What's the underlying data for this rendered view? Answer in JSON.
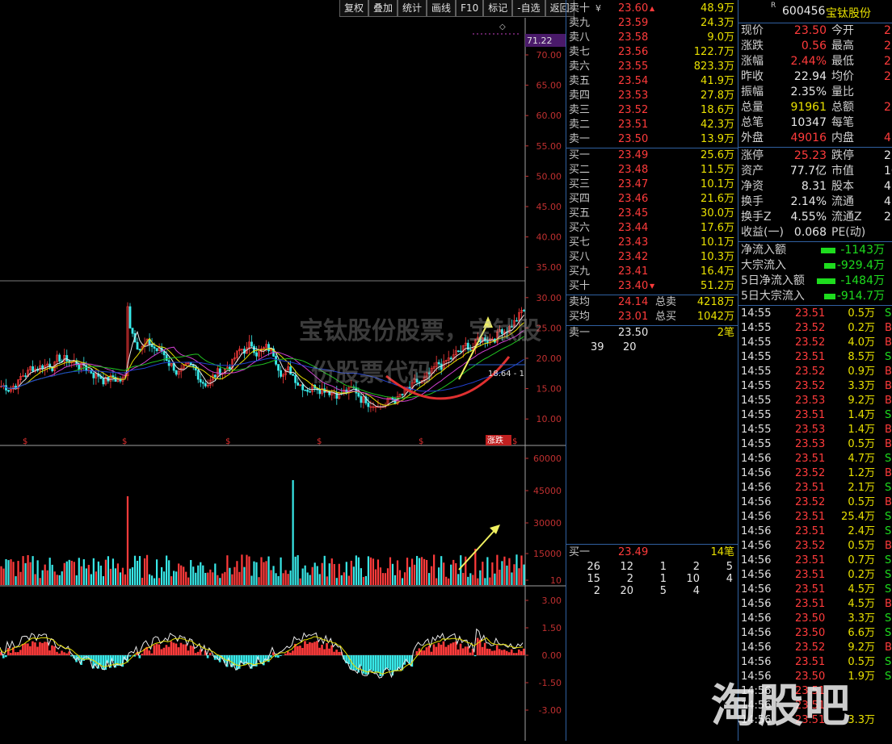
{
  "toolbar": [
    "复权",
    "叠加",
    "统计",
    "画线",
    "F10",
    "标记",
    "-自选",
    "返回"
  ],
  "price_axis": [
    "70.00",
    "65.00",
    "60.00",
    "55.00",
    "50.00",
    "45.00",
    "40.00",
    "35.00",
    "30.00",
    "25.00",
    "20.00",
    "15.00",
    "10.00"
  ],
  "price_axis_top_label": "71.22",
  "inline_label": "18.64 - 1",
  "zhangdie_badge": "涨跌",
  "marker_glyph": "$",
  "volume_axis": [
    "60000",
    "45000",
    "30000",
    "15000",
    "10"
  ],
  "macd_axis": [
    "3.00",
    "1.50",
    "0.00",
    "-1.50",
    "-3.00"
  ],
  "book": {
    "asks": [
      {
        "label": "卖十",
        "flag": "¥",
        "price": "23.60",
        "vol": "48.9万",
        "up": "▲"
      },
      {
        "label": "卖九",
        "price": "23.59",
        "vol": "24.3万"
      },
      {
        "label": "卖八",
        "price": "23.58",
        "vol": "9.0万"
      },
      {
        "label": "卖七",
        "price": "23.56",
        "vol": "122.7万"
      },
      {
        "label": "卖六",
        "price": "23.55",
        "vol": "823.3万"
      },
      {
        "label": "卖五",
        "price": "23.54",
        "vol": "41.9万"
      },
      {
        "label": "卖四",
        "price": "23.53",
        "vol": "27.8万"
      },
      {
        "label": "卖三",
        "price": "23.52",
        "vol": "18.6万"
      },
      {
        "label": "卖二",
        "price": "23.51",
        "vol": "42.3万"
      },
      {
        "label": "卖一",
        "price": "23.50",
        "vol": "13.9万"
      }
    ],
    "bids": [
      {
        "label": "买一",
        "price": "23.49",
        "vol": "25.6万"
      },
      {
        "label": "买二",
        "price": "23.48",
        "vol": "11.5万"
      },
      {
        "label": "买三",
        "price": "23.47",
        "vol": "10.1万"
      },
      {
        "label": "买四",
        "price": "23.46",
        "vol": "21.6万"
      },
      {
        "label": "买五",
        "price": "23.45",
        "vol": "30.0万"
      },
      {
        "label": "买六",
        "price": "23.44",
        "vol": "17.6万"
      },
      {
        "label": "买七",
        "price": "23.43",
        "vol": "10.1万"
      },
      {
        "label": "买八",
        "price": "23.42",
        "vol": "10.3万"
      },
      {
        "label": "买九",
        "price": "23.41",
        "vol": "16.4万"
      },
      {
        "label": "买十",
        "price": "23.40",
        "vol": "51.2万",
        "down": "▼"
      }
    ],
    "avg": [
      {
        "label": "卖均",
        "price": "24.14",
        "k": "总卖",
        "v": "4218万"
      },
      {
        "label": "买均",
        "price": "23.01",
        "k": "总买",
        "v": "1042万"
      }
    ],
    "queue_sell": {
      "label": "卖一",
      "price": "23.50",
      "count": "2笔",
      "orders": [
        "39",
        "20"
      ]
    },
    "queue_buy": {
      "label": "买一",
      "price": "23.49",
      "count": "14笔",
      "orders": [
        [
          "26",
          "12",
          "1",
          "2",
          "5"
        ],
        [
          "15",
          "2",
          "1",
          "10",
          "4"
        ],
        [
          "2",
          "20",
          "5",
          "4"
        ]
      ]
    }
  },
  "quote": {
    "flag": "R",
    "code": "600456",
    "name": "宝钛股份",
    "rows1": [
      {
        "k1": "现价",
        "v1": "23.50",
        "c1": "red",
        "k2": "今开",
        "v2": "2"
      },
      {
        "k1": "涨跌",
        "v1": "0.56",
        "c1": "red",
        "k2": "最高",
        "v2": "2"
      },
      {
        "k1": "涨幅",
        "v1": "2.44%",
        "c1": "red",
        "k2": "最低",
        "v2": "2"
      },
      {
        "k1": "昨收",
        "v1": "22.94",
        "c1": "white",
        "k2": "均价",
        "v2": "2"
      },
      {
        "k1": "振幅",
        "v1": "2.35%",
        "c1": "white",
        "k2": "量比",
        "v2": ""
      },
      {
        "k1": "总量",
        "v1": "91961",
        "c1": "yellow",
        "k2": "总额",
        "v2": "2"
      },
      {
        "k1": "总笔",
        "v1": "10347",
        "c1": "white",
        "k2": "每笔",
        "v2": ""
      },
      {
        "k1": "外盘",
        "v1": "49016",
        "c1": "red",
        "k2": "内盘",
        "v2": "4"
      }
    ],
    "rows2": [
      {
        "k1": "涨停",
        "v1": "25.23",
        "c1": "red",
        "k2": "跌停",
        "v2": "2"
      },
      {
        "k1": "资产",
        "v1": "77.7亿",
        "c1": "white",
        "k2": "市值",
        "v2": "10"
      },
      {
        "k1": "净资",
        "v1": "8.31",
        "c1": "white",
        "k2": "股本",
        "v2": "4."
      },
      {
        "k1": "换手",
        "v1": "2.14%",
        "c1": "white",
        "k2": "流通",
        "v2": "4."
      },
      {
        "k1": "换手Z",
        "v1": "4.55%",
        "c1": "white",
        "k2": "流通Z",
        "v2": "2."
      },
      {
        "k1": "收益(一)",
        "v1": "0.068",
        "c1": "white",
        "k2": "PE(动)",
        "v2": ""
      }
    ],
    "flows": [
      {
        "k": "净流入额",
        "v": "-1143万",
        "bar": 0.35
      },
      {
        "k": "大宗流入",
        "v": "-929.4万",
        "bar": 0.28
      },
      {
        "k": "5日净流入额",
        "v": "-1484万",
        "bar": 0.45
      },
      {
        "k": "5日大宗流入",
        "v": "-914.7万",
        "bar": 0.28
      }
    ],
    "ticks": [
      {
        "t": "14:55",
        "p": "23.51",
        "c": "red",
        "v": "0.5万",
        "s": "S"
      },
      {
        "t": "14:55",
        "p": "23.52",
        "c": "red",
        "v": "0.2万",
        "s": "B"
      },
      {
        "t": "14:55",
        "p": "23.52",
        "c": "red",
        "v": "4.0万",
        "s": "B"
      },
      {
        "t": "14:55",
        "p": "23.51",
        "c": "red",
        "v": "8.5万",
        "s": "S"
      },
      {
        "t": "14:55",
        "p": "23.52",
        "c": "red",
        "v": "0.9万",
        "s": "B"
      },
      {
        "t": "14:55",
        "p": "23.52",
        "c": "red",
        "v": "3.3万",
        "s": "B"
      },
      {
        "t": "14:55",
        "p": "23.53",
        "c": "red",
        "v": "9.2万",
        "s": "B"
      },
      {
        "t": "14:55",
        "p": "23.51",
        "c": "red",
        "v": "1.4万",
        "s": "S"
      },
      {
        "t": "14:55",
        "p": "23.53",
        "c": "red",
        "v": "1.4万",
        "s": "B"
      },
      {
        "t": "14:55",
        "p": "23.53",
        "c": "red",
        "v": "0.5万",
        "s": "B"
      },
      {
        "t": "14:56",
        "p": "23.51",
        "c": "red",
        "v": "4.7万",
        "s": "S"
      },
      {
        "t": "14:56",
        "p": "23.52",
        "c": "red",
        "v": "1.2万",
        "s": "B"
      },
      {
        "t": "14:56",
        "p": "23.51",
        "c": "red",
        "v": "2.1万",
        "s": "S"
      },
      {
        "t": "14:56",
        "p": "23.52",
        "c": "red",
        "v": "0.5万",
        "s": "B"
      },
      {
        "t": "14:56",
        "p": "23.51",
        "c": "red",
        "v": "25.4万",
        "s": "S"
      },
      {
        "t": "14:56",
        "p": "23.51",
        "c": "red",
        "v": "2.4万",
        "s": "S"
      },
      {
        "t": "14:56",
        "p": "23.52",
        "c": "red",
        "v": "0.5万",
        "s": "B"
      },
      {
        "t": "14:56",
        "p": "23.51",
        "c": "red",
        "v": "0.7万",
        "s": "S"
      },
      {
        "t": "14:56",
        "p": "23.51",
        "c": "red",
        "v": "0.2万",
        "s": "S"
      },
      {
        "t": "14:56",
        "p": "23.51",
        "c": "red",
        "v": "4.5万",
        "s": "S"
      },
      {
        "t": "14:56",
        "p": "23.51",
        "c": "red",
        "v": "4.5万",
        "s": "B"
      },
      {
        "t": "14:56",
        "p": "23.50",
        "c": "red",
        "v": "3.3万",
        "s": "S"
      },
      {
        "t": "14:56",
        "p": "23.50",
        "c": "red",
        "v": "6.6万",
        "s": "S"
      },
      {
        "t": "14:56",
        "p": "23.52",
        "c": "red",
        "v": "9.2万",
        "s": "B"
      },
      {
        "t": "14:56",
        "p": "23.51",
        "c": "red",
        "v": "0.5万",
        "s": "S"
      },
      {
        "t": "14:56",
        "p": "23.50",
        "c": "red",
        "v": "1.9万",
        "s": "S"
      },
      {
        "t": "14:56",
        "p": "23.51",
        "c": "red",
        "v": "",
        "s": ""
      },
      {
        "t": "14:56",
        "p": "23.51",
        "c": "red",
        "v": "",
        "s": ""
      },
      {
        "t": "14:56",
        "p": "23.51",
        "c": "red",
        "v": "3.3万",
        "s": ""
      },
      {
        "t": "14:56",
        "p": "23.51",
        "c": "red",
        "v": "0.5万",
        "s": ""
      }
    ]
  },
  "watermark": "淘股吧",
  "watermark_faint": [
    "宝钛股份股票，宝钛股",
    "份股票代码"
  ],
  "colors": {
    "up": "#ff3b3b",
    "down": "#38e8e8",
    "accent": "#e8e000",
    "panel_border": "#3060a0"
  }
}
